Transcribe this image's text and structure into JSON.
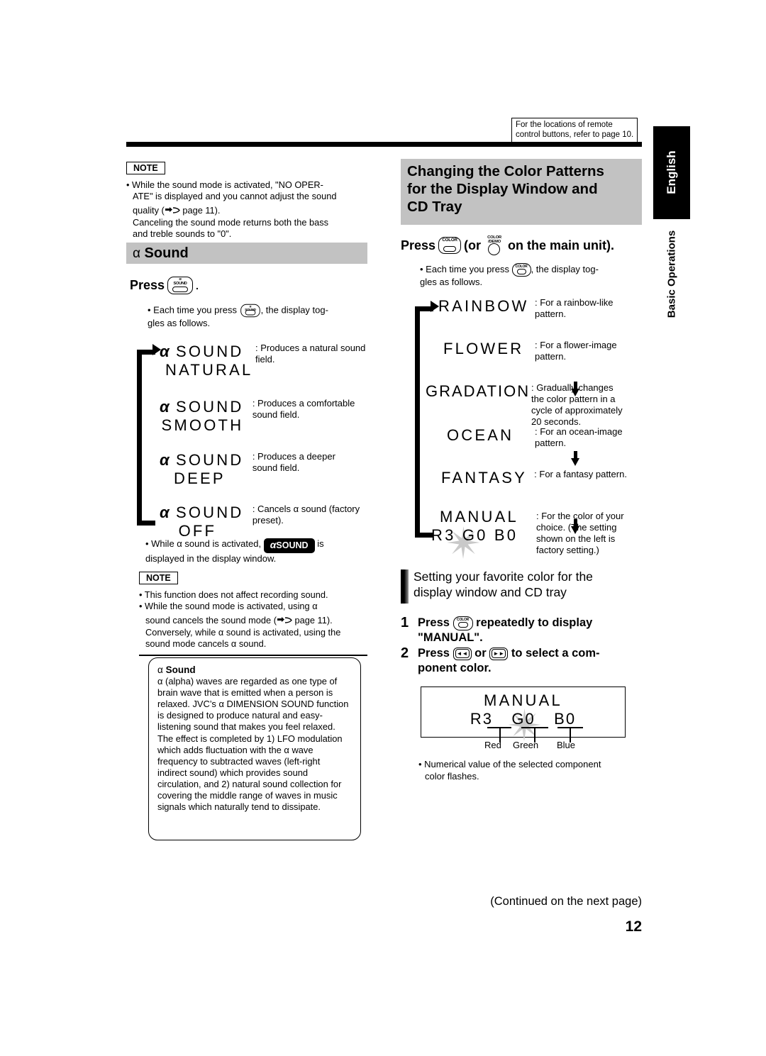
{
  "remote_note": "For the locations of remote control buttons, refer to page 10.",
  "side_tabs": {
    "english": "English",
    "section": "Basic Operations"
  },
  "note_top": {
    "label": "NOTE",
    "lines": [
      "• While the sound mode is activated, \"NO OPER-",
      "ATE\" is displayed and you cannot adjust the sound",
      "quality (☞ page 11).",
      "Canceling the sound mode returns both the bass",
      "and treble sounds to \"0\"."
    ],
    "l1": "• While the sound mode is activated, \"NO OPER-",
    "l2": "ATE\" is displayed and you cannot adjust the sound",
    "l3a": "quality (",
    "l3b": " page 11).",
    "l4": "Canceling the sound mode returns both the bass",
    "l5": "and treble sounds to \"0\"."
  },
  "alpha_section": {
    "heading_alpha": "α",
    "heading_text": "Sound",
    "press_label": "Press",
    "press_period": ".",
    "button": {
      "line1": "α",
      "line2": "SOUND",
      "name": "alpha-sound-button"
    },
    "bullet_a": "• Each time you press",
    "bullet_b": ", the display tog-",
    "bullet_c": "gles as follows.",
    "steps": [
      {
        "alpha": "α",
        "lcd1": "SOUND",
        "lcd2": "NATURAL",
        "desc1": ": Produces a natural sound",
        "desc2": "field."
      },
      {
        "alpha": "α",
        "lcd1": "SOUND",
        "lcd2": "SMOOTH",
        "desc1": ": Produces a comfortable",
        "desc2": "sound field."
      },
      {
        "alpha": "α",
        "lcd1": "SOUND",
        "lcd2": "DEEP",
        "desc1": ": Produces a deeper",
        "desc2": "sound field."
      },
      {
        "alpha": "α",
        "lcd1": "SOUND",
        "lcd2": "OFF",
        "desc1": ": Cancels α sound (factory",
        "desc2": "preset)."
      }
    ],
    "indicator_note_a": "• While α sound is activated,",
    "indicator_pill_alpha": "α",
    "indicator_pill_text": "SOUND",
    "indicator_note_b": "is",
    "indicator_note_c": "displayed in the display window."
  },
  "note_bottom": {
    "label": "NOTE",
    "l1": "• This function does not affect recording sound.",
    "l2": "• While the sound mode is activated, using α",
    "l3a": "sound cancels the sound mode (",
    "l3b": " page 11).",
    "l4": "Conversely, while α sound is activated, using the",
    "l5": "sound mode cancels α sound."
  },
  "alpha_info": {
    "title_alpha": "α",
    "title_text": "Sound",
    "body": "α (alpha) waves are regarded as one type of brain wave that is emitted when a person is relaxed. JVC’s α DIMENSION SOUND function is designed to produce natural and easy-listening sound that makes you feel relaxed. The effect is completed by 1) LFO modulation which adds fluctuation with the α wave frequency to subtracted waves (left-right indirect sound) which provides sound circulation, and 2) natural sound collection for covering the middle range of waves in music signals which naturally tend to dissipate."
  },
  "color_section": {
    "heading_l1": "Changing the Color Patterns",
    "heading_l2": "for the Display Window and",
    "heading_l3": "CD Tray",
    "press_label": "Press",
    "press_or": "(or",
    "press_tail": "on the main unit).",
    "remote_button": {
      "label": "COLOR"
    },
    "unit_button": {
      "line1": "COLOR",
      "line2": "/DEMO"
    },
    "bullet_a": "• Each time you press",
    "bullet_b": ", the display tog-",
    "bullet_c": "gles as follows.",
    "patterns": [
      {
        "lcd": "RAINBOW",
        "desc1": ": For a rainbow-like",
        "desc2": "pattern.",
        "desc3": "",
        "desc4": ""
      },
      {
        "lcd": "FLOWER",
        "desc1": ": For a flower-image",
        "desc2": "pattern.",
        "desc3": "",
        "desc4": ""
      },
      {
        "lcd": "GRADATION",
        "desc1": ": Gradually changes",
        "desc2": "the color pattern in a",
        "desc3": "cycle of approximately",
        "desc4": "20 seconds."
      },
      {
        "lcd": "OCEAN",
        "desc1": ": For an ocean-image",
        "desc2": "pattern.",
        "desc3": "",
        "desc4": ""
      },
      {
        "lcd": "FANTASY",
        "desc1": ": For a fantasy pattern.",
        "desc2": "",
        "desc3": "",
        "desc4": ""
      },
      {
        "lcd": "MANUAL",
        "lcd_sub": "R3 G0 B0",
        "desc1": ": For the color of your",
        "desc2": "choice. (The setting",
        "desc3": "shown on the left is",
        "desc4": "factory setting.)"
      }
    ]
  },
  "favorite_color": {
    "sub_l1": "Setting your favorite color for the",
    "sub_l2": "display window and CD tray",
    "step1_num": "1",
    "step1_a": "Press",
    "step1_b": "repeatedly to display",
    "step1_c": "\"MANUAL\".",
    "step2_num": "2",
    "step2_a": "Press",
    "step2_or": "or",
    "step2_b": "to select a com-",
    "step2_c": "ponent color.",
    "skip_back_glyph": "◄◄",
    "skip_fwd_glyph": "►►",
    "display": {
      "line1": "MANUAL",
      "r": "R3",
      "g": "G0",
      "b": "B0"
    },
    "legend": {
      "red": "Red",
      "green": "Green",
      "blue": "Blue"
    },
    "bullet_a": "• Numerical value of the selected component",
    "bullet_b": "color flashes."
  },
  "footer": {
    "continued": "(Continued on the next page)",
    "page": "12"
  },
  "colors": {
    "gray_head": "#c2c2c2",
    "black": "#000000",
    "burst_gray": "#c9c9c9"
  }
}
